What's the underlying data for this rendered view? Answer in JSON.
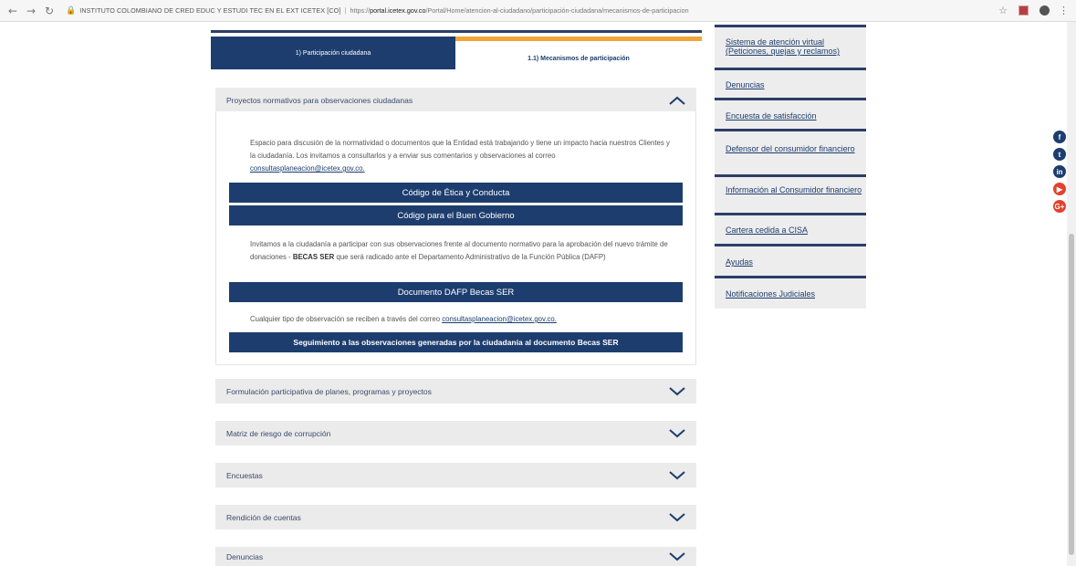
{
  "browser": {
    "site_name": "INSTITUTO COLOMBIANO DE CRED EDUC Y ESTUDI TEC EN EL EXT ICETEX [CO]",
    "url_prefix": "https://",
    "url_host": "portal.icetex.gov.co",
    "url_path": "/Portal/Home/atencion-al-ciudadano/participación-ciudadana/mecanismos-de-participacion"
  },
  "tabs": [
    {
      "label": "1) Participación ciudadana"
    },
    {
      "label": "1.1) Mecanismos de participación"
    }
  ],
  "accordion": {
    "open_title": "Proyectos normativos para observaciones ciudadanas",
    "intro": "Espacio para discusión de la normatividad o documentos que la Entidad está trabajando y tiene un impacto hacia nuestros Clientes y la ciudadanía. Los invitamos a consultarlos y a enviar sus comentarios y observaciones al correo",
    "email": "consultasplaneacion@icetex.gov.co.",
    "buttons": [
      "Código de Ética y Conducta",
      "Código para el Buen Gobierno"
    ],
    "invite_text_1": "Invitamos a la ciudadanía a participar con sus observaciones frente al documento normativo para la aprobación del nuevo trámite de donaciones - ",
    "invite_bold": "BECAS SER",
    "invite_text_2": " que será radicado ante el Departamento Administrativo de la Función Pública (DAFP)",
    "doc_button": "Documento DAFP Becas SER",
    "obs_text": "Cualquier tipo de observación se reciben a través del correo",
    "obs_email": "consultasplaneacion@icetex.gov.co.",
    "follow_button": "Seguimiento a las observaciones generadas por la ciudadanía al documento Becas SER",
    "collapsed": [
      "Formulación participativa de planes, programas y proyectos",
      "Matriz de riesgo de corrupción",
      "Encuestas",
      "Rendición de cuentas",
      "Denuncias"
    ]
  },
  "sidebar": {
    "links": [
      "Sistema de atención virtual (Peticiones, quejas y reclamos)",
      "Denuncias",
      "Encuesta de satisfacción",
      "Defensor del consumidor financiero",
      "Información al Consumidor financiero",
      "Cartera cedida a CISA",
      "Ayudas",
      "Notificaciones Judiciales"
    ]
  },
  "social": [
    {
      "name": "facebook-icon",
      "glyph": "f",
      "color": "#1d3d6e"
    },
    {
      "name": "twitter-icon",
      "glyph": "t",
      "color": "#1d3d6e"
    },
    {
      "name": "linkedin-icon",
      "glyph": "in",
      "color": "#1d3d6e"
    },
    {
      "name": "youtube-icon",
      "glyph": "▶",
      "color": "#e2422e"
    },
    {
      "name": "google-plus-icon",
      "glyph": "G+",
      "color": "#e2422e"
    }
  ],
  "colors": {
    "primary": "#1d3d6e",
    "accent": "#f0a53b",
    "panel_bg": "#ebebeb",
    "sidebar_bg": "#ededed",
    "social_red": "#e2422e"
  }
}
